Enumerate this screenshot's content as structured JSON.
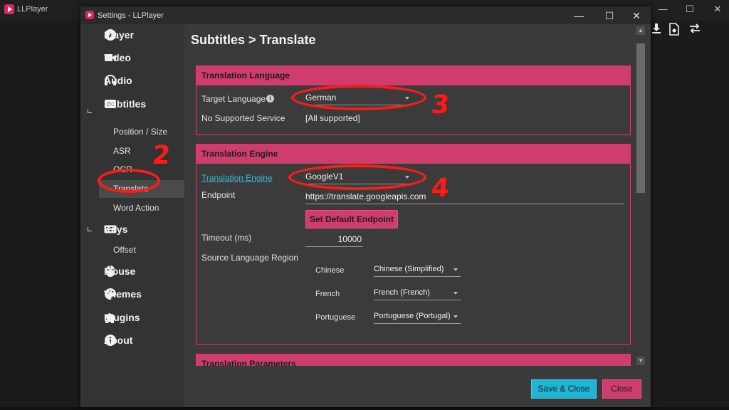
{
  "background_window": {
    "title": "LLPlayer",
    "controls": {
      "minimize": "—",
      "maximize": "☐",
      "close": "✕"
    }
  },
  "dialog": {
    "title": "Settings - LLPlayer",
    "controls": {
      "minimize": "—",
      "maximize": "☐",
      "close": "✕"
    }
  },
  "sidebar": {
    "player": "Player",
    "video": "Video",
    "audio": "Audio",
    "subtitles": "Subtitles",
    "subtitles_items": [
      "Position / Size",
      "ASR",
      "OCR",
      "Translate",
      "Word Action"
    ],
    "keys": "Keys",
    "keys_items": [
      "Offset"
    ],
    "mouse": "Mouse",
    "themes": "Themes",
    "plugins": "Plugins",
    "about": "About",
    "active_item": "Translate"
  },
  "page": {
    "title": "Subtitles > Translate"
  },
  "translation_language": {
    "header": "Translation Language",
    "target_label": "Target Language",
    "target_value": "German",
    "no_service_label": "No Supported Service",
    "no_service_value": "[All supported]"
  },
  "translation_engine": {
    "header": "Translation Engine",
    "engine_label": "Translation Engine",
    "engine_value": "GoogleV1",
    "endpoint_label": "Endpoint",
    "endpoint_value": "https://translate.googleapis.com",
    "set_default_button": "Set Default Endpoint",
    "timeout_label": "Timeout (ms)",
    "timeout_value": "10000",
    "source_region_label": "Source Language Region",
    "regions": [
      {
        "language": "Chinese",
        "value": "Chinese (Simplified)"
      },
      {
        "language": "French",
        "value": "French (French)"
      },
      {
        "language": "Portuguese",
        "value": "Portuguese (Portugal)"
      }
    ]
  },
  "translation_parameters": {
    "header": "Translation Parameters"
  },
  "footer": {
    "save_close": "Save & Close",
    "close": "Close"
  },
  "annotations": {
    "step_2": "2",
    "step_3": "3",
    "step_4": "4",
    "color": "#ff1a1a"
  },
  "colors": {
    "accent_pink": "#cf3d6d",
    "accent_cyan": "#1fb5d4",
    "link": "#3ab8d8"
  }
}
